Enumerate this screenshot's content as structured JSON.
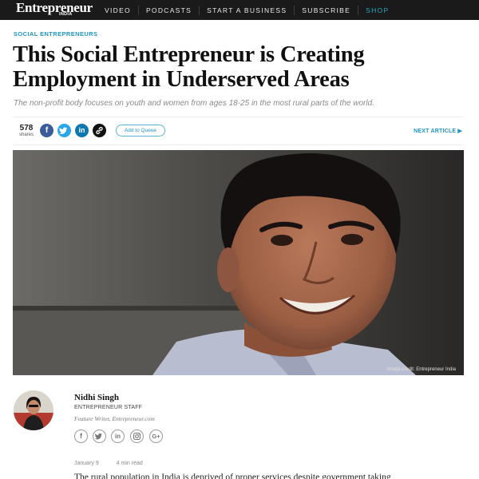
{
  "nav": {
    "logo": "Entrepreneur",
    "logo_sub": "INDIA",
    "links": [
      "VIDEO",
      "PODCASTS",
      "START A BUSINESS",
      "SUBSCRIBE",
      "SHOP"
    ]
  },
  "article": {
    "category": "SOCIAL ENTREPRENEURS",
    "headline": "This Social Entrepreneur is Creating Employment in Underserved Areas",
    "subhead": "The non-profit body focuses on youth and women from ages 18-25 in the most rural parts of the world.",
    "share_count": "578",
    "share_label": "shares",
    "queue_label": "Add to Queue",
    "next_label": "NEXT ARTICLE",
    "image_credit": "Image credit: Entrepreneur India",
    "date": "January 9",
    "read_time": "4 min read",
    "body_start": "The rural population in India is deprived of proper services despite government taking"
  },
  "author": {
    "name": "Nidhi Singh",
    "role": "ENTREPRENEUR STAFF",
    "title": "Feature Writer, Entrepreneur.com"
  },
  "icons": {
    "share": [
      "facebook-icon",
      "twitter-icon",
      "linkedin-icon",
      "link-icon"
    ],
    "author_social": [
      "facebook-icon",
      "twitter-icon",
      "linkedin-icon",
      "instagram-icon",
      "google-plus-icon"
    ]
  },
  "colors": {
    "nav_bg": "#1a1a1a",
    "accent": "#2196c4",
    "shop": "#2aa7c4",
    "facebook": "#3b5b99",
    "twitter": "#2aa7e8",
    "linkedin": "#0c77b0"
  }
}
